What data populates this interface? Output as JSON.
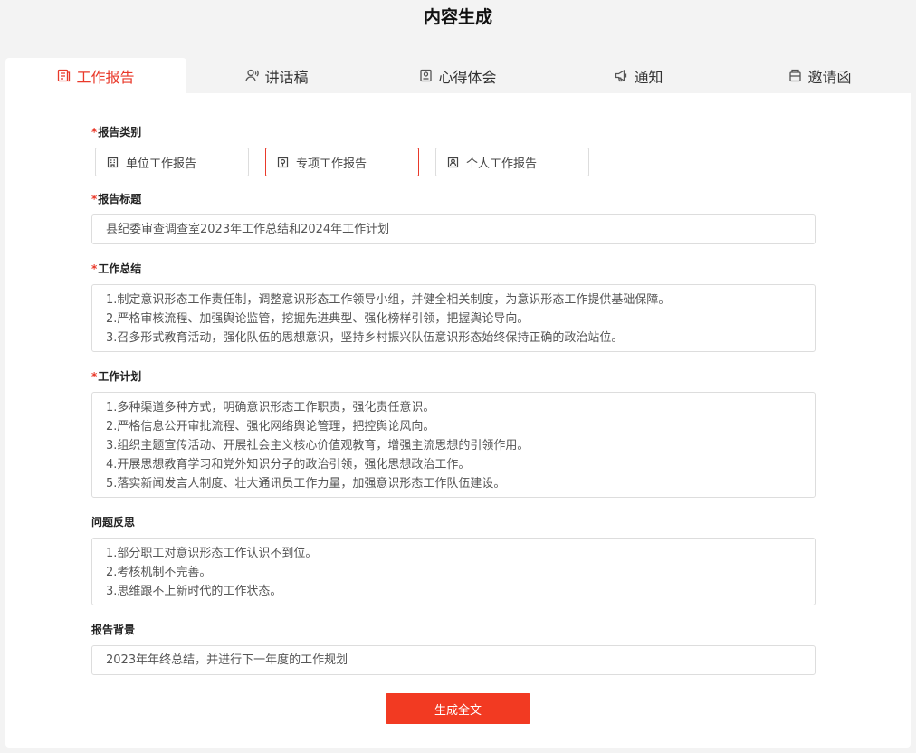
{
  "page": {
    "title": "内容生成"
  },
  "tabs": [
    {
      "label": "工作报告",
      "icon": "document-icon",
      "active": true
    },
    {
      "label": "讲话稿",
      "icon": "user-speech-icon"
    },
    {
      "label": "心得体会",
      "icon": "notebook-icon"
    },
    {
      "label": "通知",
      "icon": "megaphone-icon"
    },
    {
      "label": "邀请函",
      "icon": "invitation-icon"
    }
  ],
  "form": {
    "report_type": {
      "label": "报告类别",
      "required": true,
      "options": [
        {
          "label": "单位工作报告",
          "icon": "building-icon"
        },
        {
          "label": "专项工作报告",
          "icon": "target-doc-icon",
          "selected": true
        },
        {
          "label": "个人工作报告",
          "icon": "person-card-icon"
        }
      ]
    },
    "title": {
      "label": "报告标题",
      "required": true,
      "value": "县纪委审查调查室2023年工作总结和2024年工作计划"
    },
    "summary": {
      "label": "工作总结",
      "required": true,
      "lines": [
        "1.制定意识形态工作责任制，调整意识形态工作领导小组，并健全相关制度，为意识形态工作提供基础保障。",
        "2.严格审核流程、加强舆论监管，挖掘先进典型、强化榜样引领，把握舆论导向。",
        "3.召多形式教育活动，强化队伍的思想意识，坚持乡村振兴队伍意识形态始终保持正确的政治站位。"
      ]
    },
    "plan": {
      "label": "工作计划",
      "required": true,
      "lines": [
        "1.多种渠道多种方式，明确意识形态工作职责，强化责任意识。",
        "2.严格信息公开审批流程、强化网络舆论管理，把控舆论风向。",
        "3.组织主题宣传活动、开展社会主义核心价值观教育，增强主流思想的引领作用。",
        "4.开展思想教育学习和党外知识分子的政治引领，强化思想政治工作。",
        "5.落实新闻发言人制度、壮大通讯员工作力量，加强意识形态工作队伍建设。"
      ]
    },
    "reflection": {
      "label": "问题反思",
      "required": false,
      "lines": [
        "1.部分职工对意识形态工作认识不到位。",
        "2.考核机制不完善。",
        "3.思维跟不上新时代的工作状态。"
      ]
    },
    "background": {
      "label": "报告背景",
      "required": false,
      "value": "2023年年终总结，并进行下一年度的工作规划"
    },
    "submit_label": "生成全文"
  },
  "colors": {
    "accent": "#e9392a",
    "button": "#f23a22"
  }
}
